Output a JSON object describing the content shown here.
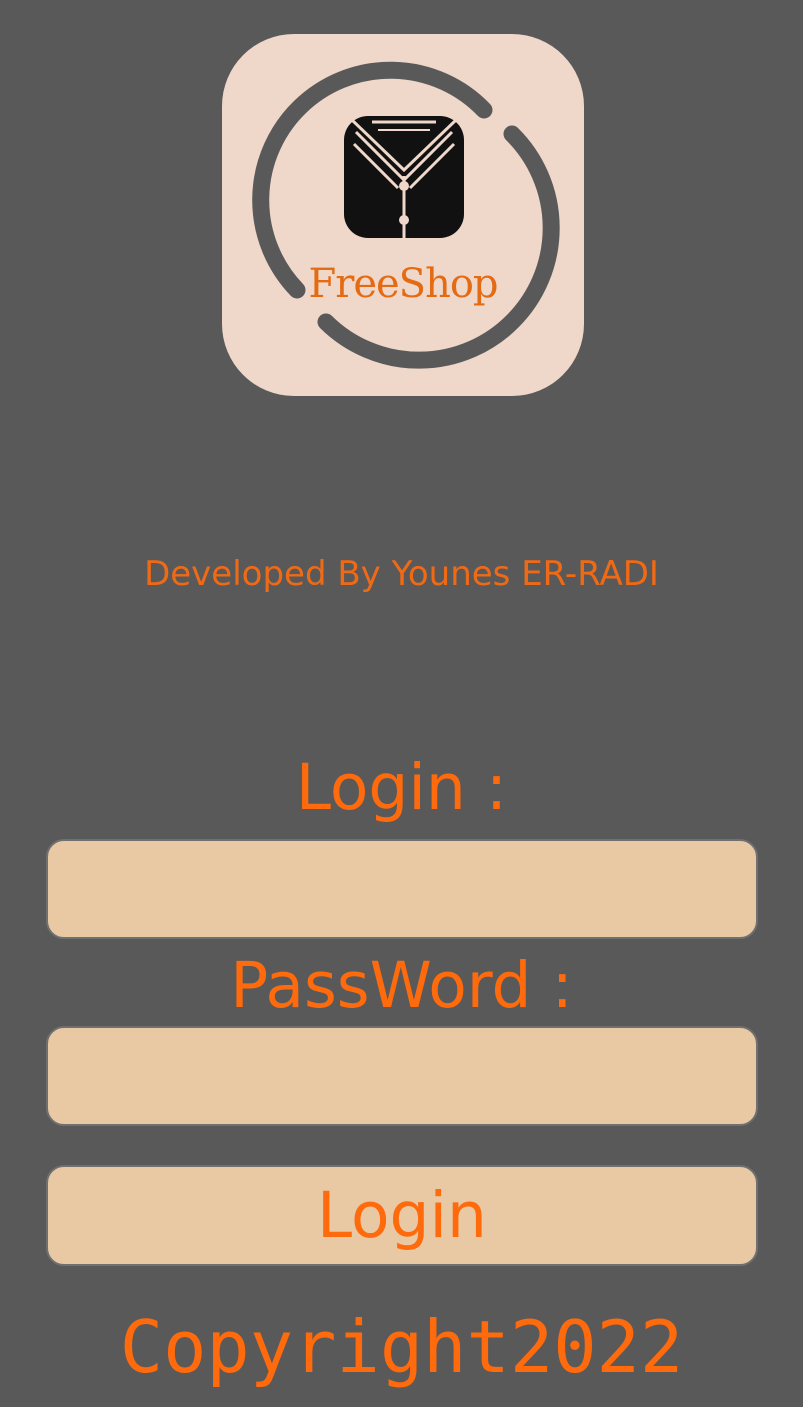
{
  "logo": {
    "text": "FreeShop",
    "icon": "shirt-icon"
  },
  "developer_credit": "Developed By Younes ER-RADI",
  "form": {
    "login_label": "Login :",
    "login_value": "",
    "password_label": "PassWord :",
    "password_value": "",
    "submit_label": "Login"
  },
  "footer": {
    "copyright": "Copyright2022"
  },
  "colors": {
    "background": "#595959",
    "accent": "#ff6a0d",
    "field_fill": "#e9c9a3",
    "logo_bg": "#efd7c9"
  }
}
